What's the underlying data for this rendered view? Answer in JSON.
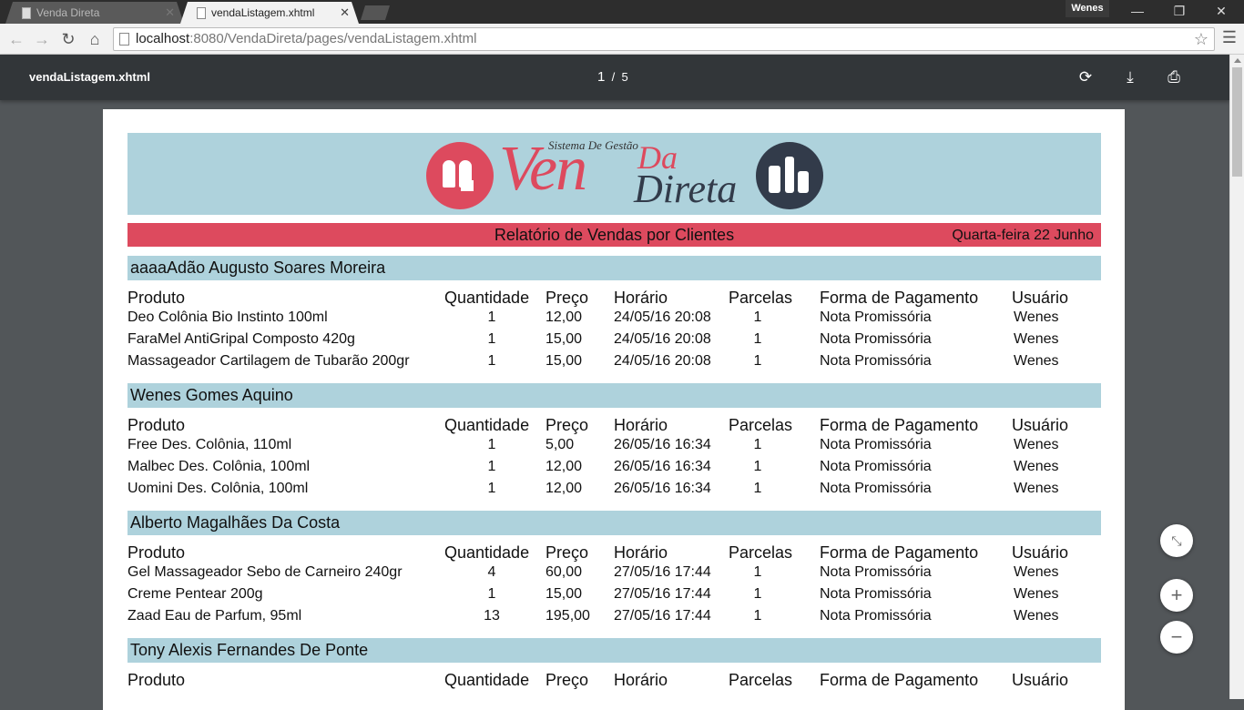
{
  "browser": {
    "tabs": [
      {
        "title": "Venda Direta",
        "active": false
      },
      {
        "title": "vendaListagem.xhtml",
        "active": true
      }
    ],
    "profile": "Wenes",
    "url_host": "localhost",
    "url_rest": ":8080/VendaDireta/pages/vendaListagem.xhtml"
  },
  "pdf": {
    "title": "vendaListagem.xhtml",
    "current_page": "1",
    "separator": "/",
    "total_pages": "5"
  },
  "report": {
    "logo_tagline": "Sistema De Gestão",
    "logo_ven": "Ven",
    "logo_da": "Da",
    "logo_direta": "Direta",
    "title": "Relatório de Vendas por Clientes",
    "date": "Quarta-feira 22 Junho",
    "columns": [
      "Produto",
      "Quantidade",
      "Preço",
      "Horário",
      "Parcelas",
      "Forma de Pagamento",
      "Usuário"
    ],
    "groups": [
      {
        "client": "aaaaAdão Augusto Soares Moreira",
        "rows": [
          [
            "Deo Colônia Bio Instinto 100ml",
            "1",
            "12,00",
            "24/05/16 20:08",
            "1",
            "Nota Promissória",
            "Wenes"
          ],
          [
            "FaraMel  AntiGripal Composto 420g",
            "1",
            "15,00",
            "24/05/16 20:08",
            "1",
            "Nota Promissória",
            "Wenes"
          ],
          [
            "Massageador Cartilagem de Tubarão 200gr",
            "1",
            "15,00",
            "24/05/16 20:08",
            "1",
            "Nota Promissória",
            "Wenes"
          ]
        ]
      },
      {
        "client": "Wenes Gomes Aquino",
        "rows": [
          [
            "Free Des. Colônia, 110ml",
            "1",
            "5,00",
            "26/05/16 16:34",
            "1",
            "Nota Promissória",
            "Wenes"
          ],
          [
            "Malbec Des. Colônia, 100ml",
            "1",
            "12,00",
            "26/05/16 16:34",
            "1",
            "Nota Promissória",
            "Wenes"
          ],
          [
            "Uomini Des. Colônia, 100ml",
            "1",
            "12,00",
            "26/05/16 16:34",
            "1",
            "Nota Promissória",
            "Wenes"
          ]
        ]
      },
      {
        "client": "Alberto Magalhães Da Costa",
        "rows": [
          [
            "Gel Massageador Sebo de Carneiro 240gr",
            "4",
            "60,00",
            "27/05/16 17:44",
            "1",
            "Nota Promissória",
            "Wenes"
          ],
          [
            "Creme Pentear 200g",
            "1",
            "15,00",
            "27/05/16 17:44",
            "1",
            "Nota Promissória",
            "Wenes"
          ],
          [
            "Zaad Eau de Parfum, 95ml",
            "13",
            "195,00",
            "27/05/16 17:44",
            "1",
            "Nota Promissória",
            "Wenes"
          ]
        ]
      },
      {
        "client": "Tony Alexis Fernandes De Ponte",
        "rows": []
      }
    ]
  }
}
